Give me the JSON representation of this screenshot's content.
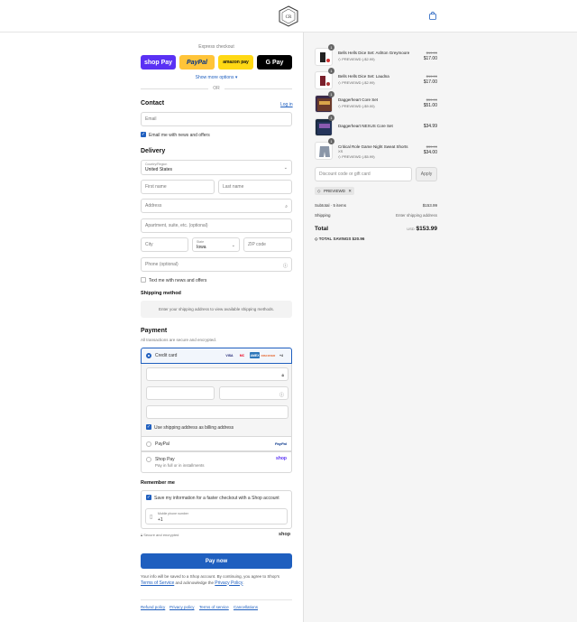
{
  "header": {
    "logo_text": "CR",
    "bag_icon": "shopping-bag-icon"
  },
  "express": {
    "title": "Express checkout",
    "buttons": [
      "shop Pay",
      "PayPal",
      "amazon pay",
      "G Pay"
    ],
    "show_more": "Show more options ▾",
    "or": "OR"
  },
  "contact": {
    "title": "Contact",
    "login": "Log in",
    "email_placeholder": "Email",
    "news_label": "Email me with news and offers"
  },
  "delivery": {
    "title": "Delivery",
    "country_label": "Country/Region",
    "country_value": "United States",
    "first_name": "First name",
    "last_name": "Last name",
    "address": "Address",
    "apartment": "Apartment, suite, etc. (optional)",
    "city": "City",
    "state_label": "State",
    "state_value": "Iowa",
    "zip": "ZIP code",
    "phone": "Phone (optional)",
    "text_label": "Text me with news and offers"
  },
  "shipping": {
    "title": "Shipping method",
    "message": "Enter your shipping address to view available shipping methods."
  },
  "payment": {
    "title": "Payment",
    "subtitle": "All transactions are secure and encrypted.",
    "credit_card": "Credit card",
    "brands": [
      "VISA",
      "MC",
      "AMEX",
      "DISCOVER"
    ],
    "more_brands": "+4",
    "billing_label": "Use shipping address as billing address",
    "paypal": "PayPal",
    "paypal_logo": "PayPal",
    "shoppay": "Shop Pay",
    "shoppay_sub": "Pay in full or in installments",
    "shoppay_logo": "shop"
  },
  "remember": {
    "title": "Remember me",
    "save_label": "Save my information for a faster checkout with a Shop account",
    "mobile_label": "Mobile phone number",
    "mobile_value": "+1",
    "secure": "Secure and encrypted",
    "shop_logo": "shop"
  },
  "pay_now": "Pay now",
  "disclaimer": {
    "part1": "Your info will be saved to a Shop account. By continuing, you agree to Shop's ",
    "terms": "Terms of Service",
    "part2": " and acknowledge the ",
    "privacy": "Privacy Policy",
    "part3": "."
  },
  "footer": [
    "Refund policy",
    "Privacy policy",
    "Terms of service",
    "Cancellations"
  ],
  "order": {
    "items": [
      {
        "qty": "1",
        "name": "Bells Hells Dice Set: Ashton Greymoore",
        "sub": "PREVIEWD (-$2.99)",
        "old": "$19.99",
        "price": "$17.00"
      },
      {
        "qty": "1",
        "name": "Bells Hells Dice Set: Laudna",
        "sub": "PREVIEWD (-$2.99)",
        "old": "$19.99",
        "price": "$17.00"
      },
      {
        "qty": "1",
        "name": "Daggerheart Core Set",
        "sub": "PREVIEWD (-$9.00)",
        "old": "$59.99",
        "price": "$51.00"
      },
      {
        "qty": "1",
        "name": "Daggerheart NEXUS Core Set",
        "sub": "",
        "old": "",
        "price": "$34.99"
      },
      {
        "qty": "1",
        "name": "Critical Role Game Night Sweat Shorts",
        "sub": "XS",
        "sub2": "PREVIEWD (-$5.99)",
        "old": "$39.99",
        "price": "$34.00"
      }
    ],
    "discount_placeholder": "Discount code or gift card",
    "apply": "Apply",
    "tag": "PREVIEWD",
    "subtotal_label": "Subtotal · 5 items",
    "subtotal": "$153.99",
    "shipping_label": "Shipping",
    "shipping_value": "Enter shipping address",
    "total_label": "Total",
    "currency": "USD",
    "total": "$153.99",
    "savings_label": "TOTAL SAVINGS",
    "savings": "$20.96"
  }
}
